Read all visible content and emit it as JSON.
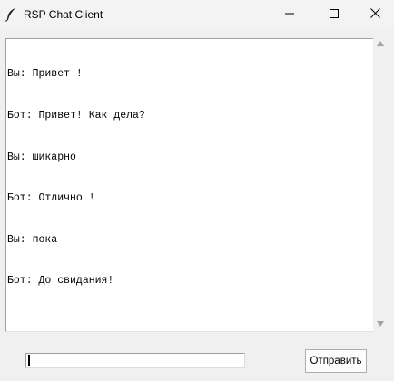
{
  "window": {
    "title": "RSP Chat Client",
    "icon": "feather-icon",
    "controls": [
      "minimize-icon",
      "maximize-icon",
      "close-icon"
    ]
  },
  "chat": {
    "messages": [
      "Вы: Привет !",
      "Бот: Привет! Как дела?",
      "Вы: шикарно",
      "Бот: Отлично !",
      "Вы: пока",
      "Бот: До свидания!"
    ]
  },
  "input": {
    "value": ""
  },
  "send_button": {
    "label": "Отправить"
  }
}
